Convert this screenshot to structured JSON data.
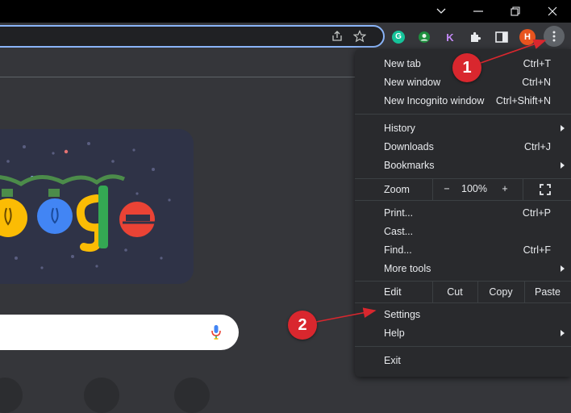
{
  "menu": {
    "new_tab": {
      "label": "New tab",
      "shortcut": "Ctrl+T"
    },
    "new_window": {
      "label": "New window",
      "shortcut": "Ctrl+N"
    },
    "new_incognito": {
      "label": "New Incognito window",
      "shortcut": "Ctrl+Shift+N"
    },
    "history": {
      "label": "History"
    },
    "downloads": {
      "label": "Downloads",
      "shortcut": "Ctrl+J"
    },
    "bookmarks": {
      "label": "Bookmarks"
    },
    "zoom": {
      "label": "Zoom",
      "minus": "−",
      "level": "100%",
      "plus": "+"
    },
    "print": {
      "label": "Print...",
      "shortcut": "Ctrl+P"
    },
    "cast": {
      "label": "Cast..."
    },
    "find": {
      "label": "Find...",
      "shortcut": "Ctrl+F"
    },
    "more_tools": {
      "label": "More tools"
    },
    "edit": {
      "label": "Edit",
      "cut": "Cut",
      "copy": "Copy",
      "paste": "Paste"
    },
    "settings": {
      "label": "Settings"
    },
    "help": {
      "label": "Help"
    },
    "exit": {
      "label": "Exit"
    }
  },
  "toolbar": {
    "ext_k_letter": "K",
    "profile_initial": "H",
    "grammarly_letter": "G"
  },
  "annotations": {
    "badge_1": "1",
    "badge_2": "2"
  },
  "colors": {
    "menu_bg": "#292a2d",
    "page_bg": "#35363a",
    "badge_red": "#d9272e",
    "profile_orange": "#e8541e",
    "grammarly_green": "#15c39a"
  },
  "icons": [
    "minimize-icon",
    "restore-icon",
    "close-icon",
    "share-icon",
    "star-icon",
    "puzzle-icon",
    "side-panel-icon",
    "kebab-menu-icon",
    "microphone-icon",
    "fullscreen-icon",
    "chevron-right-icon"
  ]
}
